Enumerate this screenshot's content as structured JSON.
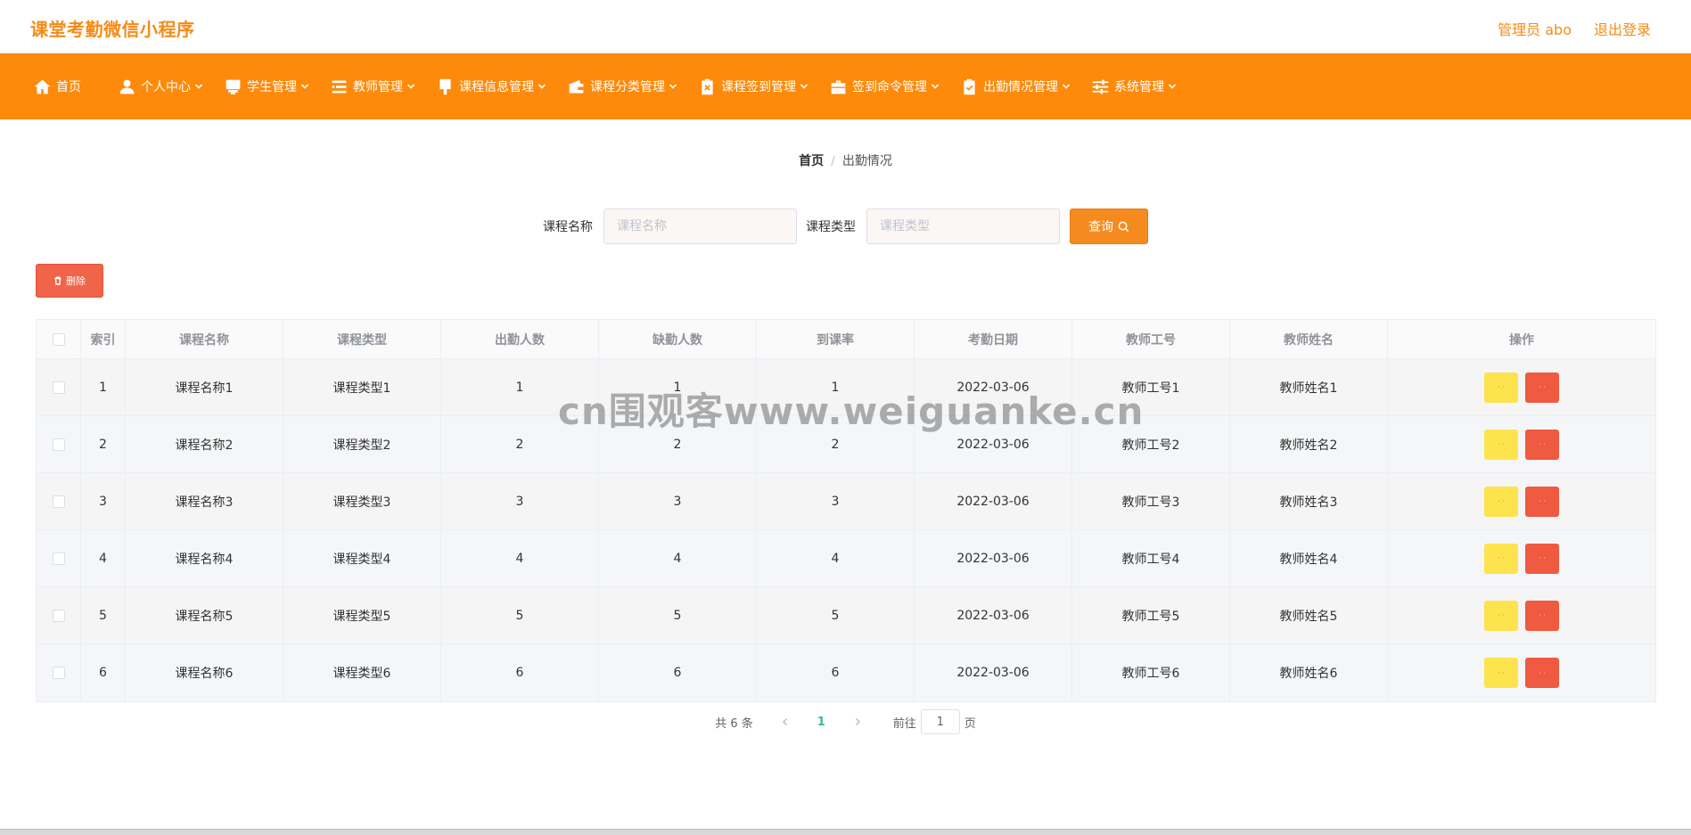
{
  "app": {
    "title": "课堂考勤微信小程序"
  },
  "user": {
    "label": "管理员 abo",
    "logout": "退出登录"
  },
  "nav": {
    "items": [
      {
        "label": "首页",
        "icon": "home-icon"
      },
      {
        "label": "个人中心",
        "icon": "user-icon"
      },
      {
        "label": "学生管理",
        "icon": "student-icon"
      },
      {
        "label": "教师管理",
        "icon": "list-icon"
      },
      {
        "label": "课程信息管理",
        "icon": "brush-icon"
      },
      {
        "label": "课程分类管理",
        "icon": "wallet-icon"
      },
      {
        "label": "课程签到管理",
        "icon": "clipboard-x-icon"
      },
      {
        "label": "签到命令管理",
        "icon": "briefcase-icon"
      },
      {
        "label": "出勤情况管理",
        "icon": "clipboard-check-icon"
      },
      {
        "label": "系统管理",
        "icon": "sliders-icon"
      }
    ]
  },
  "breadcrumb": {
    "home": "首页",
    "separator": "/",
    "current": "出勤情况"
  },
  "search": {
    "course_name_label": "课程名称",
    "course_name_placeholder": "课程名称",
    "course_type_label": "课程类型",
    "course_type_placeholder": "课程类型",
    "query_label": "查询"
  },
  "delete_label": "删除",
  "table": {
    "headers": [
      "索引",
      "课程名称",
      "课程类型",
      "出勤人数",
      "缺勤人数",
      "到课率",
      "考勤日期",
      "教师工号",
      "教师姓名",
      "操作"
    ],
    "rows": [
      [
        "1",
        "课程名称1",
        "课程类型1",
        "1",
        "1",
        "1",
        "2022-03-06",
        "教师工号1",
        "教师姓名1"
      ],
      [
        "2",
        "课程名称2",
        "课程类型2",
        "2",
        "2",
        "2",
        "2022-03-06",
        "教师工号2",
        "教师姓名2"
      ],
      [
        "3",
        "课程名称3",
        "课程类型3",
        "3",
        "3",
        "3",
        "2022-03-06",
        "教师工号3",
        "教师姓名3"
      ],
      [
        "4",
        "课程名称4",
        "课程类型4",
        "4",
        "4",
        "4",
        "2022-03-06",
        "教师工号4",
        "教师姓名4"
      ],
      [
        "5",
        "课程名称5",
        "课程类型5",
        "5",
        "5",
        "5",
        "2022-03-06",
        "教师工号5",
        "教师姓名5"
      ],
      [
        "6",
        "课程名称6",
        "课程类型6",
        "6",
        "6",
        "6",
        "2022-03-06",
        "教师工号6",
        "教师姓名6"
      ]
    ],
    "edit_label": "· ·",
    "delete_label": "· ·"
  },
  "watermark": "cn围观客www.weiguanke.cn",
  "pagination": {
    "total": "共 6 条",
    "current_page": "1",
    "goto_prefix": "前往",
    "goto_value": "1",
    "goto_suffix": "页"
  },
  "colors": {
    "brand": "#fd8a0b",
    "title": "#f58b16",
    "danger": "#ef5a40",
    "warning": "#fde34e",
    "page_active": "#3bb88f"
  }
}
